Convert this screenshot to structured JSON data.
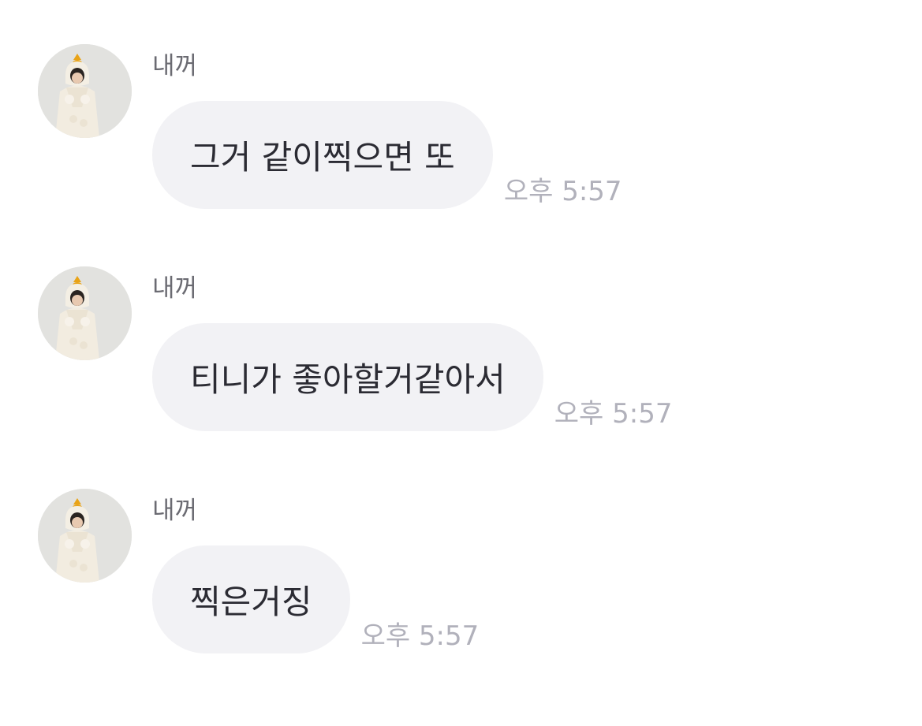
{
  "messages": [
    {
      "sender": "내꺼",
      "text": "그거 같이찍으면 또",
      "time": "오후 5:57"
    },
    {
      "sender": "내꺼",
      "text": "티니가 좋아할거같아서",
      "time": "오후 5:57"
    },
    {
      "sender": "내꺼",
      "text": "찍은거징",
      "time": "오후 5:57"
    }
  ]
}
